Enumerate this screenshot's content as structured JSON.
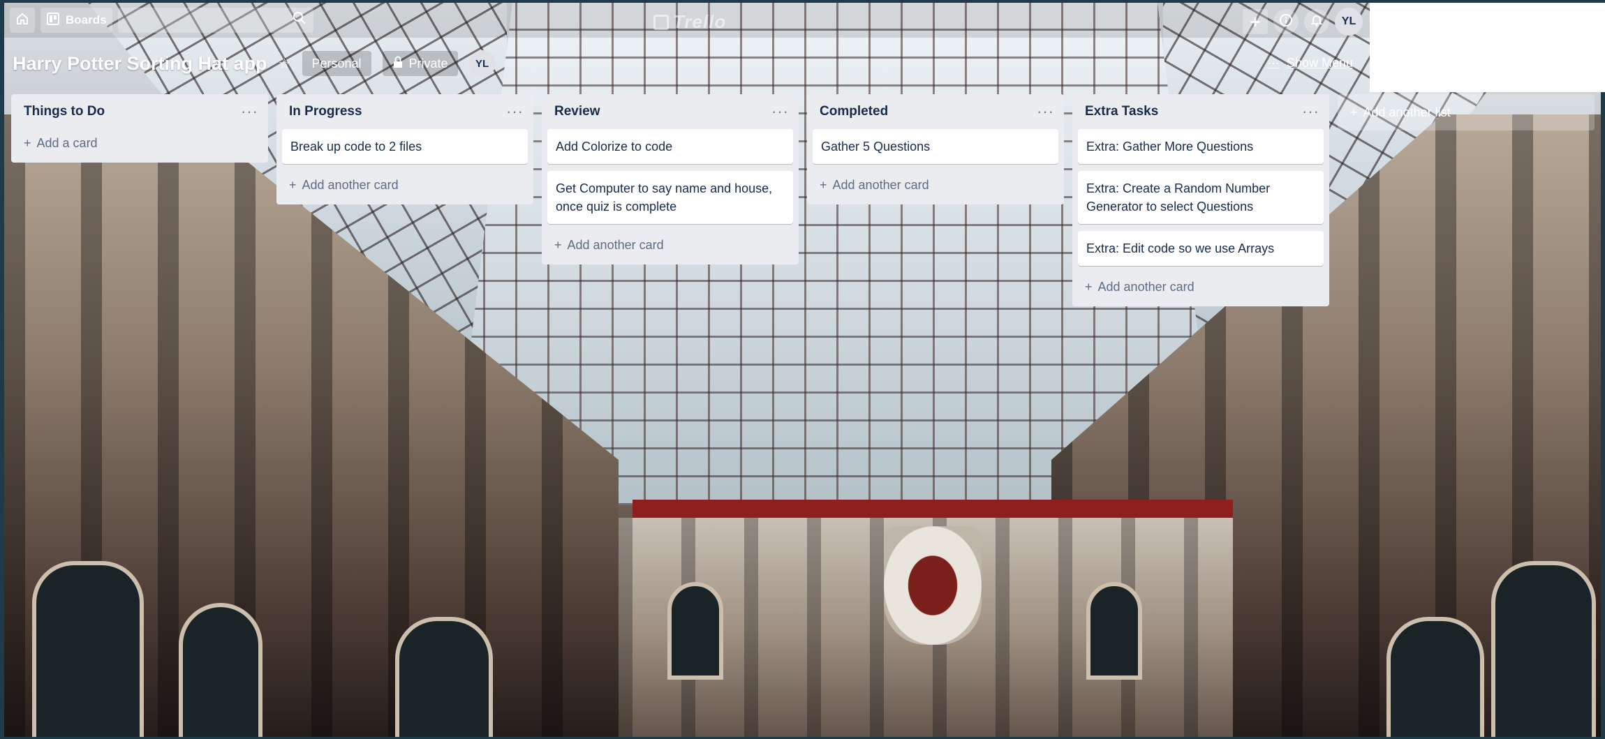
{
  "header": {
    "boards_label": "Boards",
    "logo_text": "Trello"
  },
  "user": {
    "initials": "YL"
  },
  "board": {
    "title": "Harry Potter Sorting Hat app",
    "team_label": "Personal",
    "visibility_label": "Private",
    "show_menu_label": "Show Menu"
  },
  "lists": [
    {
      "title": "Things to Do",
      "cards": [],
      "add_label": "Add a card"
    },
    {
      "title": "In Progress",
      "cards": [
        "Break up code to 2 files"
      ],
      "add_label": "Add another card"
    },
    {
      "title": "Review",
      "cards": [
        "Add Colorize to code",
        "Get Computer to say name and house, once quiz is complete"
      ],
      "add_label": "Add another card"
    },
    {
      "title": "Completed",
      "cards": [
        "Gather 5 Questions"
      ],
      "add_label": "Add another card"
    },
    {
      "title": "Extra Tasks",
      "cards": [
        "Extra: Gather More Questions",
        "Extra: Create a Random Number Generator to select Questions",
        "Extra: Edit code so we use Arrays"
      ],
      "add_label": "Add another card"
    }
  ],
  "add_list_label": "Add another list",
  "icons": {
    "home": "home-icon",
    "boards": "boards-icon",
    "search": "search-icon",
    "plus": "plus-icon",
    "info": "info-icon",
    "bell": "bell-icon",
    "star": "star-icon",
    "lock": "lock-icon",
    "more": "more-icon"
  },
  "colors": {
    "list_bg": "#ebecf0",
    "card_text": "#172b4d",
    "muted_text": "#5e6c84"
  }
}
